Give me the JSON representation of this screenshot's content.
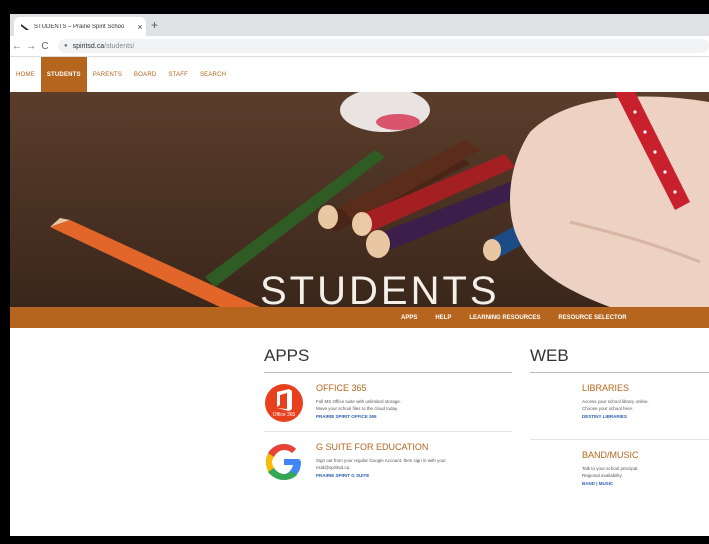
{
  "browser": {
    "tab_title": "STUDENTS – Prairie Spirit Schoo",
    "close_glyph": "×",
    "new_tab_glyph": "+",
    "back_glyph": "←",
    "forward_glyph": "→",
    "reload_glyph": "C",
    "url_host": "spiritsd.ca",
    "url_path": "/students/"
  },
  "site_nav": {
    "items": [
      {
        "label": "HOME",
        "active": false
      },
      {
        "label": "STUDENTS",
        "active": true
      },
      {
        "label": "PARENTS",
        "active": false
      },
      {
        "label": "BOARD",
        "active": false
      },
      {
        "label": "STAFF",
        "active": false
      },
      {
        "label": "SEARCH",
        "active": false
      }
    ]
  },
  "hero": {
    "caption": "STUDENTS"
  },
  "sub_nav": {
    "items": [
      "APPS",
      "HELP",
      "LEARNING RESOURCES",
      "RESOURCE SELECTOR"
    ]
  },
  "apps": {
    "heading": "APPS",
    "items": [
      {
        "title": "OFFICE 365",
        "logo_text": "Office 365",
        "desc1": "Full MS Office suite with unlimited storage.",
        "desc2": "Move your school files to the cloud today.",
        "link": "PRAIRIE SPIRIT OFFICE 365"
      },
      {
        "title": "G SUITE FOR EDUCATION",
        "desc1": "Sign out from your regular Google Account, then sign in with your",
        "desc2": "nsid@spiritsd.ca.",
        "link": "PRAIRIE SPIRIT G SUITE"
      }
    ]
  },
  "web": {
    "heading": "WEB",
    "items": [
      {
        "title": "LIBRARIES",
        "desc1": "Access your school library online.",
        "desc2": "Choose your school here.",
        "link": "DESTINY LIBRARIES"
      },
      {
        "title": "BAND/MUSIC",
        "desc1": "Talk to your school principal.",
        "desc2": "Regional availability.",
        "link": "BAND | MUSIC"
      }
    ]
  },
  "colors": {
    "brand": "#b5651d",
    "link": "#2a5fb0"
  }
}
